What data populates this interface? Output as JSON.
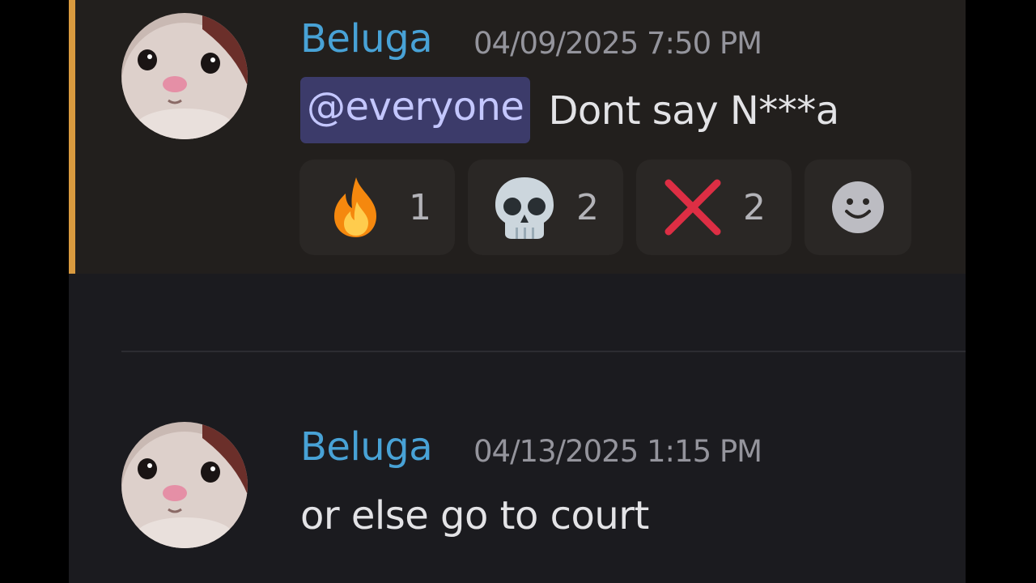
{
  "messages": [
    {
      "username": "Beluga",
      "timestamp": "04/09/2025 7:50 PM",
      "mention": "@everyone",
      "text": "Dont say N***a",
      "reactions": [
        {
          "emoji": "fire-icon",
          "count": "1"
        },
        {
          "emoji": "skull-icon",
          "count": "2"
        },
        {
          "emoji": "cross-mark-icon",
          "count": "2"
        }
      ],
      "add_reaction_icon": "smiley-face-icon"
    },
    {
      "username": "Beluga",
      "timestamp": "04/13/2025 1:15 PM",
      "text": "or else go to court"
    }
  ],
  "colors": {
    "username": "#48a2d6",
    "mention_bg": "#3c3b6a",
    "mention_text": "#c4c7ff",
    "highlight_bar": "#d99a3f",
    "background": "#1b1b1f",
    "highlight_bg": "#221f1d"
  }
}
